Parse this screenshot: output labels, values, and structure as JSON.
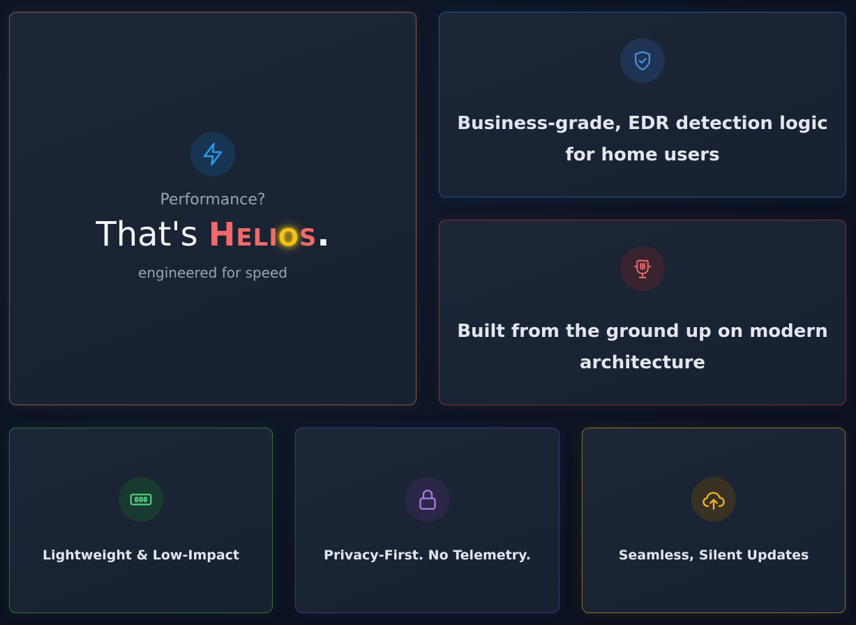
{
  "hero": {
    "icon": "lightning-bolt-icon",
    "kicker": "Performance?",
    "title_prefix": "That's ",
    "brand": {
      "letter_1": "H",
      "letters_2_4": "ELI",
      "letter_5": "O",
      "letter_6": "S"
    },
    "title_suffix": ".",
    "subtitle": "engineered for speed"
  },
  "features": {
    "edr": {
      "icon": "shield-check-icon",
      "label": "Business-grade, EDR detection logic for home users"
    },
    "architecture": {
      "icon": "chip-icon",
      "label": "Built from the ground up on modern architecture"
    },
    "lightweight": {
      "icon": "memory-icon",
      "label": "Lightweight & Low-Impact"
    },
    "privacy": {
      "icon": "lock-icon",
      "label": "Privacy-First. No Telemetry."
    },
    "updates": {
      "icon": "cloud-upload-icon",
      "label": "Seamless, Silent Updates"
    }
  },
  "colors": {
    "brand": "#f06a6a",
    "brand_glow": "#f3c316",
    "blue_accent": "#3b8ee8",
    "red_accent": "#e56a6a",
    "green_accent": "#4cc77a",
    "purple_accent": "#a879e8",
    "amber_accent": "#f0b429"
  }
}
